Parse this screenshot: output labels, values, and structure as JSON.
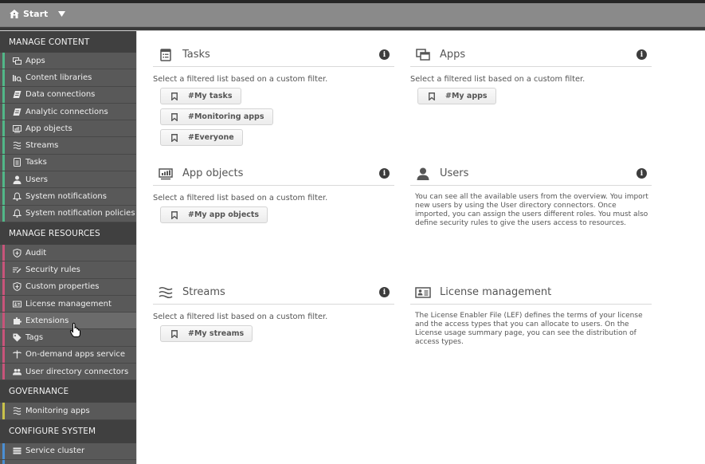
{
  "topbar": {
    "start_label": "Start",
    "home_icon": "home-icon",
    "dropdown_icon": "caret-down-icon"
  },
  "sidebar": {
    "sections": [
      {
        "title": "MANAGE CONTENT",
        "accent": "#52b788",
        "items": [
          {
            "label": "Apps",
            "icon": "apps-icon"
          },
          {
            "label": "Content libraries",
            "icon": "content-libraries-icon"
          },
          {
            "label": "Data connections",
            "icon": "data-connections-icon"
          },
          {
            "label": "Analytic connections",
            "icon": "analytic-connections-icon"
          },
          {
            "label": "App objects",
            "icon": "app-objects-icon"
          },
          {
            "label": "Streams",
            "icon": "streams-icon"
          },
          {
            "label": "Tasks",
            "icon": "tasks-icon"
          },
          {
            "label": "Users",
            "icon": "user-icon"
          },
          {
            "label": "System notifications",
            "icon": "bell-icon"
          },
          {
            "label": "System notification policies",
            "icon": "bell-icon"
          }
        ]
      },
      {
        "title": "MANAGE RESOURCES",
        "accent": "#c8547a",
        "items": [
          {
            "label": "Audit",
            "icon": "shield-icon"
          },
          {
            "label": "Security rules",
            "icon": "security-rules-icon"
          },
          {
            "label": "Custom properties",
            "icon": "shield-icon"
          },
          {
            "label": "License management",
            "icon": "license-icon"
          },
          {
            "label": "Extensions",
            "icon": "puzzle-icon",
            "hovered": true
          },
          {
            "label": "Tags",
            "icon": "tag-icon"
          },
          {
            "label": "On-demand apps service",
            "icon": "on-demand-icon"
          },
          {
            "label": "User directory connectors",
            "icon": "users-group-icon"
          }
        ]
      },
      {
        "title": "GOVERNANCE",
        "accent": "#c9c24a",
        "items": [
          {
            "label": "Monitoring apps",
            "icon": "streams-icon"
          }
        ]
      },
      {
        "title": "CONFIGURE SYSTEM",
        "accent": "#4a8fd4",
        "items": [
          {
            "label": "Service cluster",
            "icon": "service-cluster-icon"
          }
        ]
      }
    ]
  },
  "cards": {
    "tasks": {
      "title": "Tasks",
      "icon": "tasks-icon",
      "description": "Select a filtered list based on a custom filter.",
      "chips": [
        "#My tasks",
        "#Monitoring apps",
        "#Everyone"
      ]
    },
    "apps": {
      "title": "Apps",
      "icon": "apps-icon",
      "description": "Select a filtered list based on a custom filter.",
      "chips": [
        "#My apps"
      ]
    },
    "app_objects": {
      "title": "App objects",
      "icon": "app-objects-icon",
      "description": "Select a filtered list based on a custom filter.",
      "chips": [
        "#My app objects"
      ]
    },
    "users": {
      "title": "Users",
      "icon": "user-icon",
      "description": "You can see all the available users from the overview. You import new users by using the User directory connectors. Once imported, you can assign the users different roles. You must also define security rules to give the users access to resources."
    },
    "streams": {
      "title": "Streams",
      "icon": "streams-icon",
      "description": "Select a filtered list based on a custom filter.",
      "chips": [
        "#My streams"
      ]
    },
    "license": {
      "title": "License management",
      "icon": "license-icon",
      "description": "The License Enabler File (LEF) defines the terms of your license and the access types that you can allocate to users. On the License usage summary page, you can see the distribution of access types."
    }
  }
}
